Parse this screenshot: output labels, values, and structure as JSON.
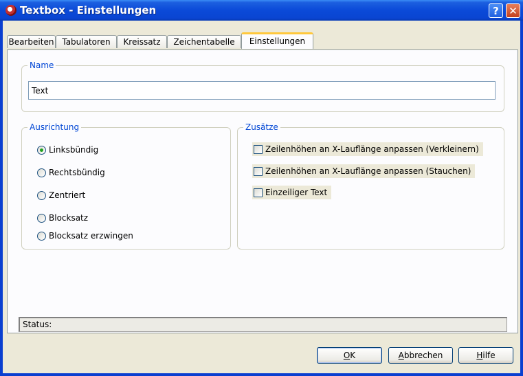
{
  "window": {
    "title": "Textbox - Einstellungen",
    "help_glyph": "?",
    "close_glyph": "✕"
  },
  "tabs": [
    {
      "label": "Bearbeiten"
    },
    {
      "label": "Tabulatoren"
    },
    {
      "label": "Kreissatz"
    },
    {
      "label": "Zeichentabelle"
    },
    {
      "label": "Einstellungen",
      "active": true
    }
  ],
  "name_group": {
    "legend": "Name",
    "value": "Text"
  },
  "align_group": {
    "legend": "Ausrichtung",
    "options": [
      {
        "label": "Linksbündig",
        "checked": true
      },
      {
        "label": "Rechtsbündig",
        "checked": false
      },
      {
        "label": "Zentriert",
        "checked": false
      },
      {
        "label": "Blocksatz",
        "checked": false
      },
      {
        "label": "Blocksatz erzwingen",
        "checked": false
      }
    ]
  },
  "extras_group": {
    "legend": "Zusätze",
    "options": [
      {
        "label": "Zeilenhöhen an X-Lauflänge anpassen (Verkleinern)",
        "checked": false
      },
      {
        "label": "Zeilenhöhen an X-Lauflänge anpassen (Stauchen)",
        "checked": false
      },
      {
        "label": "Einzeiliger Text",
        "checked": false
      }
    ]
  },
  "status": {
    "text": "Status:"
  },
  "buttons": {
    "ok": {
      "accel": "O",
      "rest": "K"
    },
    "cancel": {
      "accel": "A",
      "rest": "bbrechen"
    },
    "help": {
      "accel": "H",
      "rest": "ilfe"
    }
  },
  "colors": {
    "titlebar": "#0a45d2",
    "legend": "#0046d5",
    "face": "#ece9d8",
    "tab_highlight": "#ffc83c"
  }
}
